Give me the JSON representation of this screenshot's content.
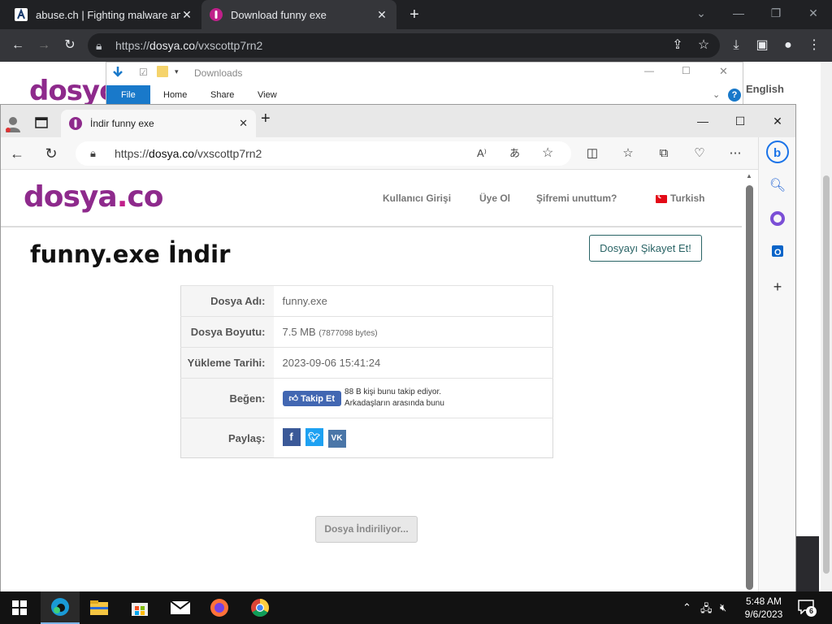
{
  "chrome": {
    "tabs": [
      {
        "title": "abuse.ch | Fighting malware and"
      },
      {
        "title": "Download funny exe"
      }
    ],
    "url_prefix": "https://",
    "url_host": "dosya.co",
    "url_path": "/vxscottp7rn2",
    "page_english": "English",
    "page_logo": "dosyc"
  },
  "explorer": {
    "title": "Downloads",
    "ribbon_tabs": [
      "File",
      "Home",
      "Share",
      "View"
    ]
  },
  "edge": {
    "tab_title": "İndir funny exe",
    "url_prefix": "https://",
    "url_host": "dosya.co",
    "url_path": "/vxscottp7rn2"
  },
  "site": {
    "logo_main": "dosya",
    "logo_dot": ".",
    "logo_tld": "co",
    "nav": {
      "login": "Kullanıcı Girişi",
      "register": "Üye Ol",
      "forgot": "Şifremi unuttum?",
      "language": "Turkish"
    },
    "title": "funny.exe İndir",
    "report_button": "Dosyayı Şikayet Et!",
    "info": {
      "filename_label": "Dosya Adı:",
      "filename": "funny.exe",
      "size_label": "Dosya Boyutu:",
      "size": "7.5 MB",
      "size_bytes": "(7877098 bytes)",
      "date_label": "Yükleme Tarihi:",
      "date": "2023-09-06 15:41:24",
      "like_label": "Beğen:",
      "follow_button": "Takip Et",
      "like_line1": "88 B kişi bunu takip ediyor.",
      "like_line2": "Arkadaşların arasında bunu",
      "share_label": "Paylaş:"
    },
    "download_button": "Dosya İndiriliyor..."
  },
  "taskbar": {
    "time": "5:48 AM",
    "date": "9/6/2023",
    "notification_count": "6"
  }
}
